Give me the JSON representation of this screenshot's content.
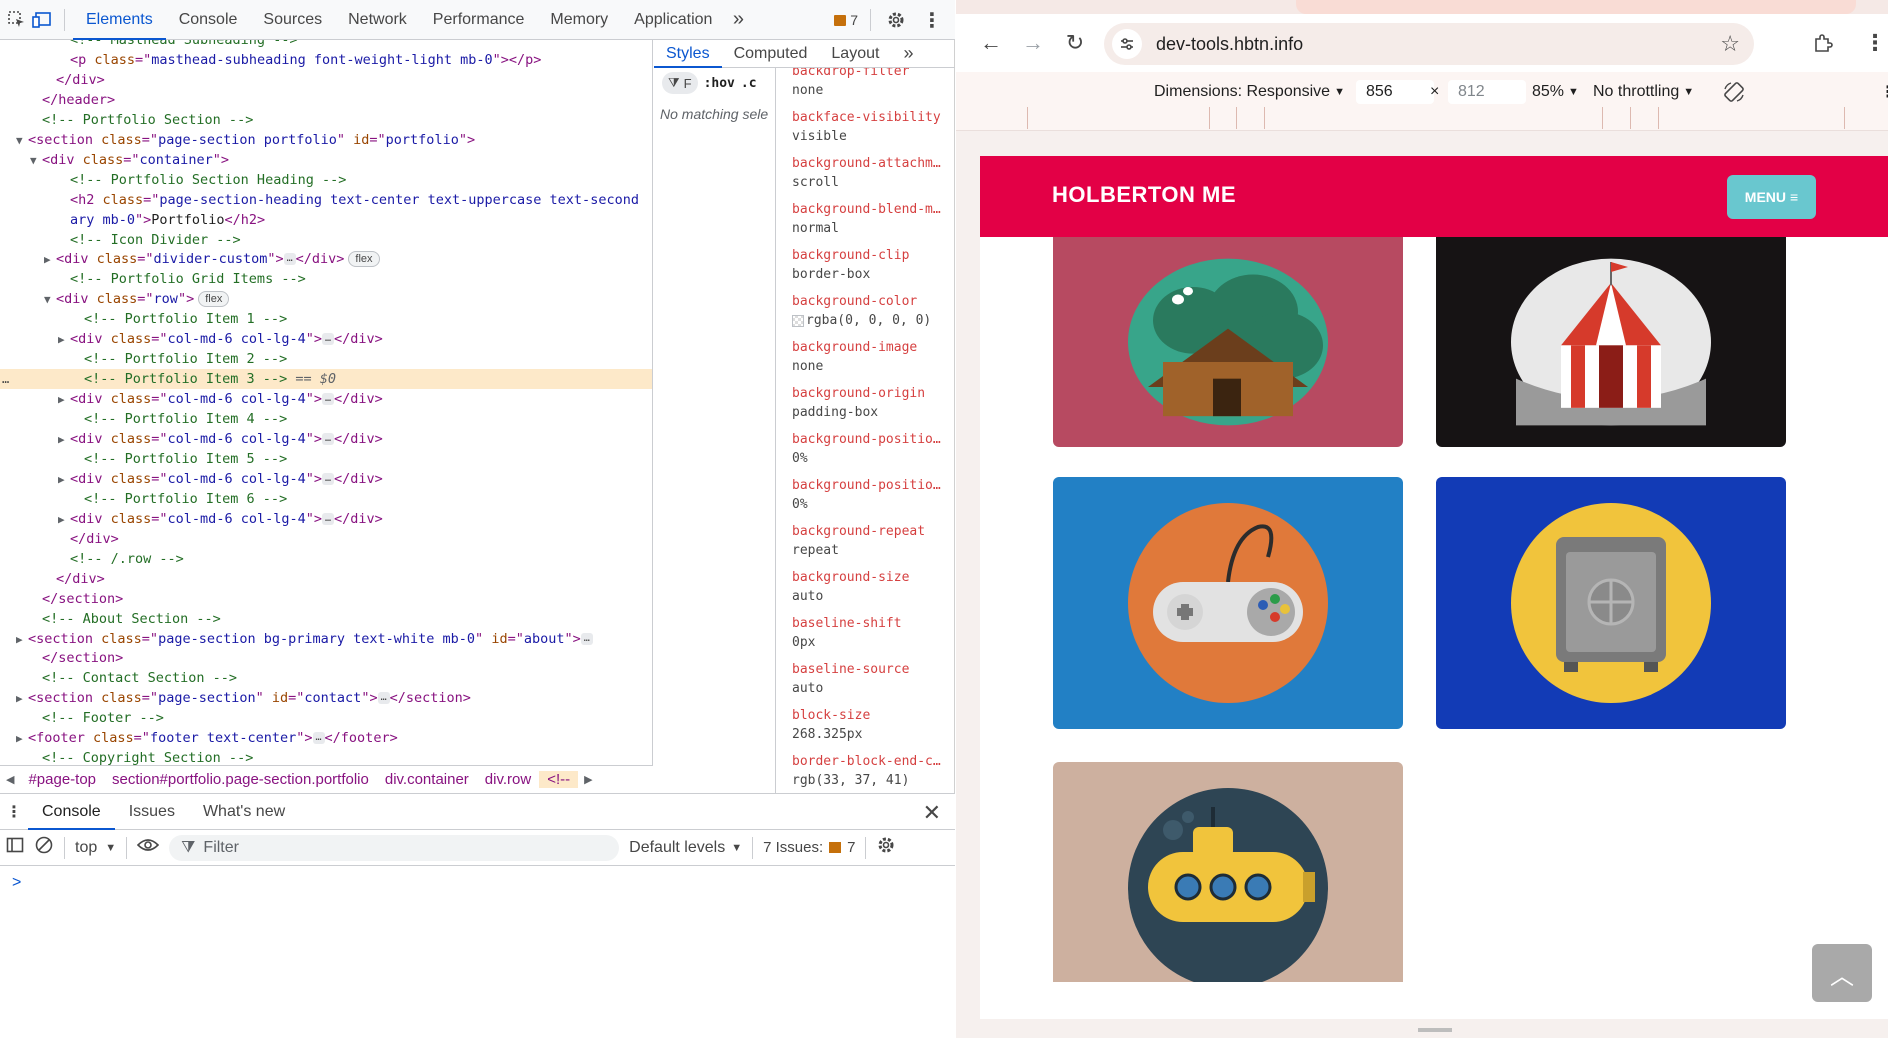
{
  "devtools": {
    "tabs": [
      "Elements",
      "Console",
      "Sources",
      "Network",
      "Performance",
      "Memory",
      "Application"
    ],
    "issues_count": "7",
    "dom_lines": [
      {
        "i": 72,
        "tri": "",
        "html": [
          [
            "com",
            "<!-- Masthead Subheading -->"
          ]
        ],
        "sel": false
      },
      {
        "i": 72,
        "tri": "",
        "html": [
          [
            "tag",
            "<p "
          ],
          [
            "attr",
            "class"
          ],
          [
            "tag",
            "=\""
          ],
          [
            "val",
            "masthead-subheading font-weight-light mb-0"
          ],
          [
            "tag",
            "\"></p>"
          ]
        ],
        "sel": false
      },
      {
        "i": 58,
        "tri": "",
        "html": [
          [
            "tag",
            "</div>"
          ]
        ],
        "sel": false
      },
      {
        "i": 44,
        "tri": "",
        "html": [
          [
            "tag",
            "</header>"
          ]
        ],
        "sel": false
      },
      {
        "i": 44,
        "tri": "",
        "html": [
          [
            "com",
            "<!-- Portfolio Section -->"
          ]
        ],
        "sel": false
      },
      {
        "i": 30,
        "tri": "▼",
        "html": [
          [
            "tag",
            "<section "
          ],
          [
            "attr",
            "class"
          ],
          [
            "tag",
            "=\""
          ],
          [
            "val",
            "page-section portfolio"
          ],
          [
            "tag",
            "\" "
          ],
          [
            "attr",
            "id"
          ],
          [
            "tag",
            "=\""
          ],
          [
            "val",
            "portfolio"
          ],
          [
            "tag",
            "\">"
          ]
        ],
        "sel": false
      },
      {
        "i": 44,
        "tri": "▼",
        "html": [
          [
            "tag",
            "<div "
          ],
          [
            "attr",
            "class"
          ],
          [
            "tag",
            "=\""
          ],
          [
            "val",
            "container"
          ],
          [
            "tag",
            "\">"
          ]
        ],
        "sel": false
      },
      {
        "i": 72,
        "tri": "",
        "html": [
          [
            "com",
            "<!-- Portfolio Section Heading -->"
          ]
        ],
        "sel": false
      },
      {
        "i": 72,
        "tri": "",
        "html": [
          [
            "tag",
            "<h2 "
          ],
          [
            "attr",
            "class"
          ],
          [
            "tag",
            "=\""
          ],
          [
            "val",
            "page-section-heading text-center text-uppercase text-second"
          ]
        ],
        "sel": false
      },
      {
        "i": 72,
        "tri": "",
        "html": [
          [
            "val",
            "ary mb-0"
          ],
          [
            "tag",
            "\">"
          ],
          [
            "txt",
            "Portfolio"
          ],
          [
            "tag",
            "</h2>"
          ]
        ],
        "sel": false
      },
      {
        "i": 72,
        "tri": "",
        "html": [
          [
            "com",
            "<!-- Icon Divider -->"
          ]
        ],
        "sel": false
      },
      {
        "i": 58,
        "tri": "▶",
        "html": [
          [
            "tag",
            "<div "
          ],
          [
            "attr",
            "class"
          ],
          [
            "tag",
            "=\""
          ],
          [
            "val",
            "divider-custom"
          ],
          [
            "tag",
            "\">"
          ],
          [
            "ell",
            "…"
          ],
          [
            "tag",
            "</div>"
          ],
          [
            "pill",
            "flex"
          ]
        ],
        "sel": false
      },
      {
        "i": 72,
        "tri": "",
        "html": [
          [
            "com",
            "<!-- Portfolio Grid Items -->"
          ]
        ],
        "sel": false
      },
      {
        "i": 58,
        "tri": "▼",
        "html": [
          [
            "tag",
            "<div "
          ],
          [
            "attr",
            "class"
          ],
          [
            "tag",
            "=\""
          ],
          [
            "val",
            "row"
          ],
          [
            "tag",
            "\">"
          ],
          [
            "pill",
            "flex"
          ]
        ],
        "sel": false
      },
      {
        "i": 86,
        "tri": "",
        "html": [
          [
            "com",
            "<!-- Portfolio Item 1 -->"
          ]
        ],
        "sel": false
      },
      {
        "i": 72,
        "tri": "▶",
        "html": [
          [
            "tag",
            "<div "
          ],
          [
            "attr",
            "class"
          ],
          [
            "tag",
            "=\""
          ],
          [
            "val",
            "col-md-6 col-lg-4"
          ],
          [
            "tag",
            "\">"
          ],
          [
            "ell",
            "…"
          ],
          [
            "tag",
            "</div>"
          ]
        ],
        "sel": false
      },
      {
        "i": 86,
        "tri": "",
        "html": [
          [
            "com",
            "<!-- Portfolio Item 2 -->"
          ]
        ],
        "sel": false
      },
      {
        "i": 86,
        "tri": "",
        "html": [
          [
            "com",
            "<!-- Portfolio Item 3 -->"
          ],
          [
            "dim",
            " == $0"
          ]
        ],
        "sel": true
      },
      {
        "i": 72,
        "tri": "▶",
        "html": [
          [
            "tag",
            "<div "
          ],
          [
            "attr",
            "class"
          ],
          [
            "tag",
            "=\""
          ],
          [
            "val",
            "col-md-6 col-lg-4"
          ],
          [
            "tag",
            "\">"
          ],
          [
            "ell",
            "…"
          ],
          [
            "tag",
            "</div>"
          ]
        ],
        "sel": false
      },
      {
        "i": 86,
        "tri": "",
        "html": [
          [
            "com",
            "<!-- Portfolio Item 4 -->"
          ]
        ],
        "sel": false
      },
      {
        "i": 72,
        "tri": "▶",
        "html": [
          [
            "tag",
            "<div "
          ],
          [
            "attr",
            "class"
          ],
          [
            "tag",
            "=\""
          ],
          [
            "val",
            "col-md-6 col-lg-4"
          ],
          [
            "tag",
            "\">"
          ],
          [
            "ell",
            "…"
          ],
          [
            "tag",
            "</div>"
          ]
        ],
        "sel": false
      },
      {
        "i": 86,
        "tri": "",
        "html": [
          [
            "com",
            "<!-- Portfolio Item 5 -->"
          ]
        ],
        "sel": false
      },
      {
        "i": 72,
        "tri": "▶",
        "html": [
          [
            "tag",
            "<div "
          ],
          [
            "attr",
            "class"
          ],
          [
            "tag",
            "=\""
          ],
          [
            "val",
            "col-md-6 col-lg-4"
          ],
          [
            "tag",
            "\">"
          ],
          [
            "ell",
            "…"
          ],
          [
            "tag",
            "</div>"
          ]
        ],
        "sel": false
      },
      {
        "i": 86,
        "tri": "",
        "html": [
          [
            "com",
            "<!-- Portfolio Item 6 -->"
          ]
        ],
        "sel": false
      },
      {
        "i": 72,
        "tri": "▶",
        "html": [
          [
            "tag",
            "<div "
          ],
          [
            "attr",
            "class"
          ],
          [
            "tag",
            "=\""
          ],
          [
            "val",
            "col-md-6 col-lg-4"
          ],
          [
            "tag",
            "\">"
          ],
          [
            "ell",
            "…"
          ],
          [
            "tag",
            "</div>"
          ]
        ],
        "sel": false
      },
      {
        "i": 72,
        "tri": "",
        "html": [
          [
            "tag",
            "</div>"
          ]
        ],
        "sel": false
      },
      {
        "i": 72,
        "tri": "",
        "html": [
          [
            "com",
            "<!-- /.row -->"
          ]
        ],
        "sel": false
      },
      {
        "i": 58,
        "tri": "",
        "html": [
          [
            "tag",
            "</div>"
          ]
        ],
        "sel": false
      },
      {
        "i": 44,
        "tri": "",
        "html": [
          [
            "tag",
            "</section>"
          ]
        ],
        "sel": false
      },
      {
        "i": 44,
        "tri": "",
        "html": [
          [
            "com",
            "<!-- About Section -->"
          ]
        ],
        "sel": false
      },
      {
        "i": 30,
        "tri": "▶",
        "html": [
          [
            "tag",
            "<section "
          ],
          [
            "attr",
            "class"
          ],
          [
            "tag",
            "=\""
          ],
          [
            "val",
            "page-section bg-primary text-white mb-0"
          ],
          [
            "tag",
            "\" "
          ],
          [
            "attr",
            "id"
          ],
          [
            "tag",
            "=\""
          ],
          [
            "val",
            "about"
          ],
          [
            "tag",
            "\">"
          ],
          [
            "ell",
            "…"
          ]
        ],
        "sel": false
      },
      {
        "i": 44,
        "tri": "",
        "html": [
          [
            "tag",
            "</section>"
          ]
        ],
        "sel": false
      },
      {
        "i": 44,
        "tri": "",
        "html": [
          [
            "com",
            "<!-- Contact Section -->"
          ]
        ],
        "sel": false
      },
      {
        "i": 30,
        "tri": "▶",
        "html": [
          [
            "tag",
            "<section "
          ],
          [
            "attr",
            "class"
          ],
          [
            "tag",
            "=\""
          ],
          [
            "val",
            "page-section"
          ],
          [
            "tag",
            "\" "
          ],
          [
            "attr",
            "id"
          ],
          [
            "tag",
            "=\""
          ],
          [
            "val",
            "contact"
          ],
          [
            "tag",
            "\">"
          ],
          [
            "ell",
            "…"
          ],
          [
            "tag",
            "</section>"
          ]
        ],
        "sel": false
      },
      {
        "i": 44,
        "tri": "",
        "html": [
          [
            "com",
            "<!-- Footer -->"
          ]
        ],
        "sel": false
      },
      {
        "i": 30,
        "tri": "▶",
        "html": [
          [
            "tag",
            "<footer "
          ],
          [
            "attr",
            "class"
          ],
          [
            "tag",
            "=\""
          ],
          [
            "val",
            "footer text-center"
          ],
          [
            "tag",
            "\">"
          ],
          [
            "ell",
            "…"
          ],
          [
            "tag",
            "</footer>"
          ]
        ],
        "sel": false
      },
      {
        "i": 44,
        "tri": "",
        "html": [
          [
            "com",
            "<!-- Copyright Section -->"
          ]
        ],
        "sel": false
      }
    ],
    "breadcrumbs": [
      "#page-top",
      "section#portfolio.page-section.portfolio",
      "div.container",
      "div.row",
      "<!--"
    ],
    "styles_tabs": [
      "Styles",
      "Computed",
      "Layout"
    ],
    "filter_label": "F",
    "hov_label": ":hov",
    "cls_label": ".c",
    "no_matching": "No matching sele",
    "computed": [
      {
        "name": "backdrop-filter",
        "value": "none"
      },
      {
        "name": "backface-visibility",
        "value": "visible"
      },
      {
        "name": "background-attachm…",
        "value": "scroll"
      },
      {
        "name": "background-blend-m…",
        "value": "normal"
      },
      {
        "name": "background-clip",
        "value": "border-box"
      },
      {
        "name": "background-color",
        "value": "rgba(0, 0, 0, 0)",
        "swatch": true
      },
      {
        "name": "background-image",
        "value": "none"
      },
      {
        "name": "background-origin",
        "value": "padding-box"
      },
      {
        "name": "background-positio…",
        "value": "0%"
      },
      {
        "name": "background-positio…",
        "value": "0%"
      },
      {
        "name": "background-repeat",
        "value": "repeat"
      },
      {
        "name": "background-size",
        "value": "auto"
      },
      {
        "name": "baseline-shift",
        "value": "0px"
      },
      {
        "name": "baseline-source",
        "value": "auto"
      },
      {
        "name": "block-size",
        "value": "268.325px"
      },
      {
        "name": "border-block-end-c…",
        "value": "rgb(33, 37, 41)"
      }
    ],
    "drawer_tabs": [
      "Console",
      "Issues",
      "What's new"
    ],
    "console": {
      "context": "top",
      "filter_placeholder": "Filter",
      "levels": "Default levels",
      "issues_label": "7 Issues:",
      "issues_count": "7",
      "prompt": ">"
    }
  },
  "browser": {
    "url": "dev-tools.hbtn.info",
    "device": {
      "dimensions_label": "Dimensions: Responsive",
      "width": "856",
      "times": "×",
      "height": "812",
      "zoom": "85%",
      "throttling": "No throttling"
    },
    "site": {
      "brand": "HOLBERTON ME",
      "menu_label": "MENU",
      "menu_icon": "hamburger-icon",
      "tiles": [
        {
          "name": "cabin",
          "bg": "#b74a61",
          "circle": "#2d8f6a"
        },
        {
          "name": "circus",
          "bg": "#161314",
          "circle": "#e8e8e8"
        },
        {
          "name": "game",
          "bg": "#2280c5",
          "circle": "#e0793a"
        },
        {
          "name": "safe",
          "bg": "#123bb6",
          "circle": "#f1c43c"
        },
        {
          "name": "submarine",
          "bg": "#cdb09f",
          "circle": "#2e4554"
        }
      ]
    },
    "colors": {
      "nav": "#e30046",
      "menu_button": "#69c7cf",
      "devtools_accent": "#0b57d0"
    }
  }
}
